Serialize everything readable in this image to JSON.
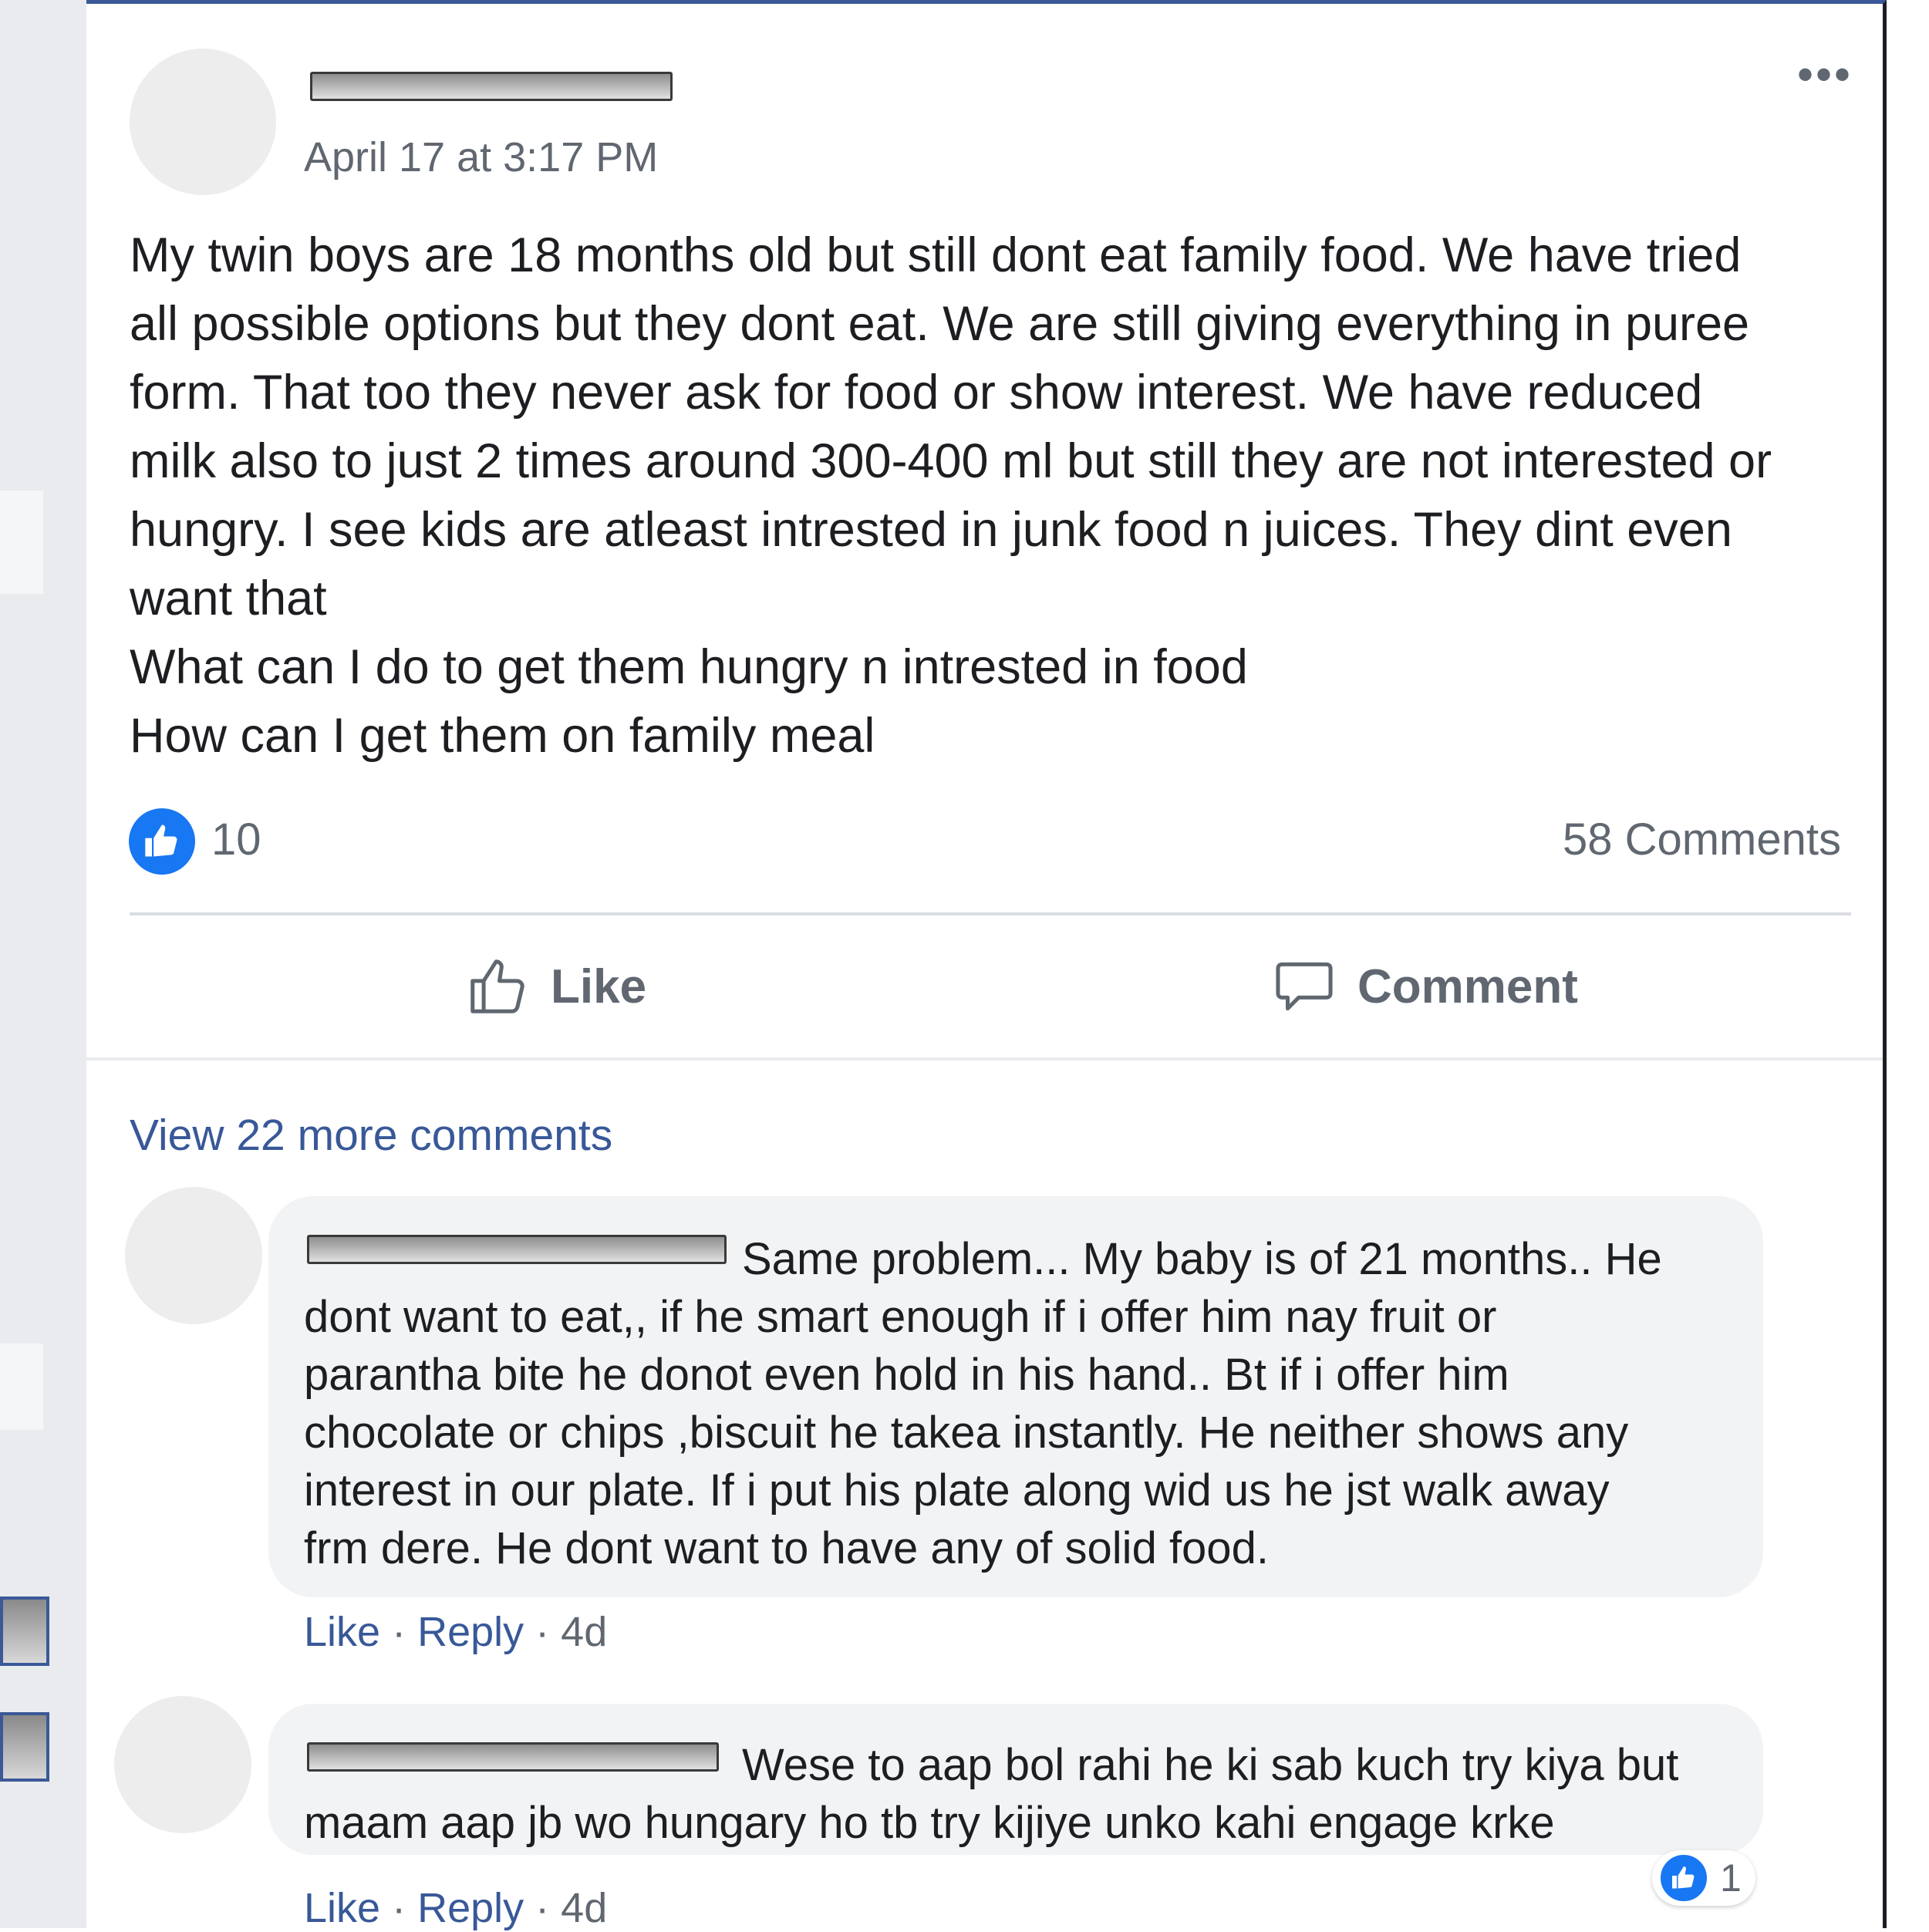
{
  "post": {
    "timestamp": "April 17 at 3:17 PM",
    "more_icon": "•••",
    "text_lines": [
      "My twin boys are 18 months old but still dont eat family food. We have tried",
      "all possible options but they dont eat. We are still giving everything in puree",
      "form. That too they never ask for food or show interest. We have reduced",
      "milk also to just 2 times around 300-400 ml but still they are not interested or",
      "hungry. I see kids are atleast intrested in junk food n juices. They dint even",
      "want that",
      "What can I do to get them hungry n intrested in food",
      "How can I get them on family meal"
    ],
    "reaction_count": "10",
    "comment_count": "58 Comments",
    "like_label": "Like",
    "comment_label": "Comment",
    "view_more": "View 22 more comments"
  },
  "comments": [
    {
      "text_lines": [
        "Same problem... My baby is of 21 months.. He",
        "dont want to eat,, if he smart enough if i offer him nay fruit or",
        "parantha bite he donot even hold in his hand.. Bt if i offer him",
        "chocolate or chips ,biscuit he takea instantly. He neither shows any",
        "interest in our plate. If i put his plate along wid us he jst walk away",
        "frm dere. He dont want to have any of solid food."
      ],
      "like": "Like",
      "reply": "Reply",
      "time": "4d"
    },
    {
      "text_lines": [
        "Wese to aap bol rahi he ki sab kuch try kiya but",
        "maam aap jb wo hungary ho tb try kijiye unko kahi engage krke"
      ],
      "like": "Like",
      "reply": "Reply",
      "time": "4d",
      "reaction_count": "1"
    }
  ],
  "colors": {
    "accent_blue": "#1877f2",
    "link_blue": "#385898",
    "muted_text": "#606770",
    "bubble_bg": "#f2f3f5"
  },
  "icons": [
    "more-options-icon",
    "like-reaction-icon",
    "thumbs-up-icon",
    "comment-icon"
  ]
}
